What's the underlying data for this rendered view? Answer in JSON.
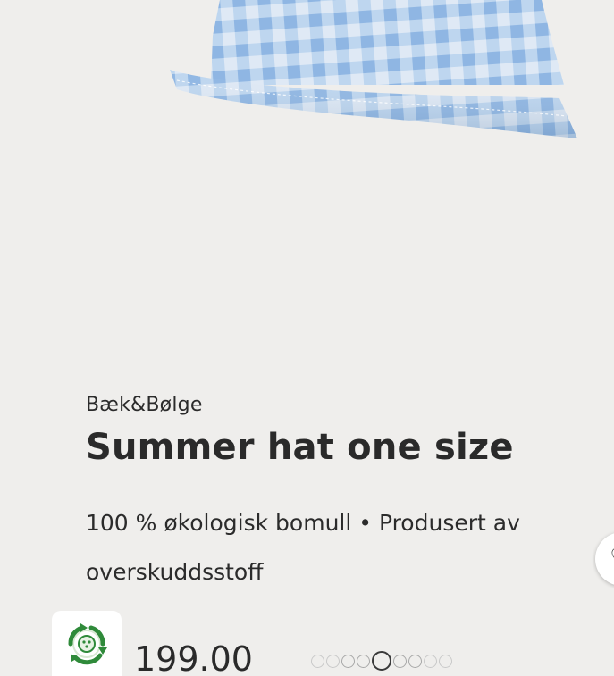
{
  "product": {
    "brand": "Bæk&Bølge",
    "title": "Summer hat one size",
    "description_line1": "100 % økologisk bomull • Produsert av",
    "description_line2": "overskuddsstoff",
    "price": "199.00",
    "image_alt": "Blue gingham bucket hat"
  },
  "carousel": {
    "dot_count": 9,
    "active_index": 4
  },
  "icons": {
    "eco": "recycle-leaf-icon",
    "favorite": "heart-icon"
  },
  "colors": {
    "card_background": "#efeeec",
    "gingham_blue": "#a9c9ea",
    "eco_green": "#2f8a3a",
    "text": "#2a2a2a"
  }
}
